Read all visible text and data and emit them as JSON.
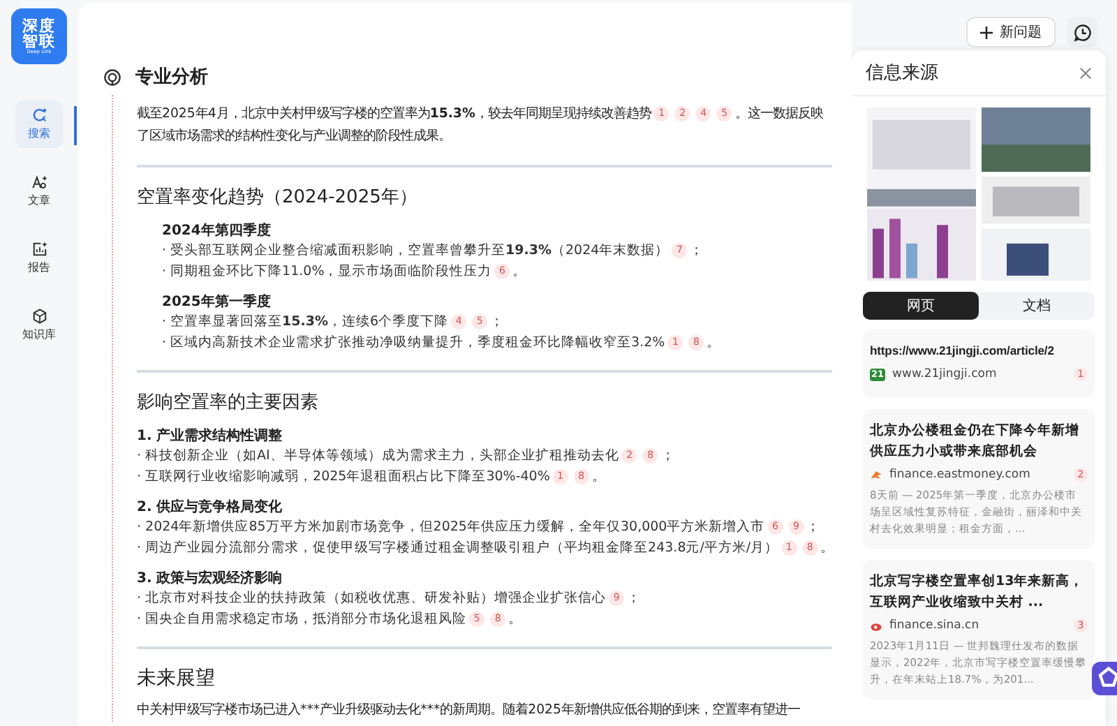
{
  "logo": {
    "line1": "深度",
    "line2": "智联",
    "sub": "Deep Link"
  },
  "nav": [
    {
      "label": "搜索",
      "selected": true
    },
    {
      "label": "文章",
      "selected": false
    },
    {
      "label": "报告",
      "selected": false
    },
    {
      "label": "知识库",
      "selected": false
    }
  ],
  "new_question_button": "新问题",
  "analysis": {
    "title": "专业分析",
    "intro": {
      "text": "截至2025年4月，北京中关村甲级写字楼的空置率为**15.3%**，较去年同期呈现持续改善趋势",
      "cites": [
        "1",
        "2",
        "4",
        "5"
      ],
      "after": "。这一数据反映了区域市场需求的结构性变化与产业调整的阶段性成果。"
    },
    "sections": [
      {
        "title": "空置率变化趋势（2024-2025年）",
        "indented": true,
        "groups": [
          {
            "title": "2024年第四季度",
            "bullets": [
              {
                "text": "· 受头部互联网企业整合缩减面积影响，空置率曾攀升至**19.3%**（2024年末数据）",
                "cites": [
                  "7"
                ],
                "after": "；"
              },
              {
                "text": "· 同期租金环比下降11.0%，显示市场面临阶段性压力",
                "cites": [
                  "6"
                ],
                "after": "。"
              }
            ]
          },
          {
            "title": "2025年第一季度",
            "bullets": [
              {
                "text": "· 空置率显著回落至**15.3%**，连续6个季度下降",
                "cites": [
                  "4",
                  "5"
                ],
                "after": "；"
              },
              {
                "text": "· 区域内高新技术企业需求扩张推动净吸纳量提升，季度租金环比降幅收窄至3.2%",
                "cites": [
                  "1",
                  "8"
                ],
                "after": "。"
              }
            ]
          }
        ]
      },
      {
        "title": "影响空置率的主要因素",
        "indented": false,
        "groups": [
          {
            "title": "1. 产业需求结构性调整",
            "bullets": [
              {
                "text": "· 科技创新企业（如AI、半导体等领域）成为需求主力，头部企业扩租推动去化",
                "cites": [
                  "2",
                  "8"
                ],
                "after": "；"
              },
              {
                "text": "· 互联网行业收缩影响减弱，2025年退租面积占比下降至30%-40%",
                "cites": [
                  "1",
                  "8"
                ],
                "after": "。"
              }
            ]
          },
          {
            "title": "2. 供应与竞争格局变化",
            "bullets": [
              {
                "text": "· 2024年新增供应85万平方米加剧市场竞争，但2025年供应压力缓解，全年仅30,000平方米新增入市",
                "cites": [
                  "6",
                  "9"
                ],
                "after": "；"
              },
              {
                "text": "· 周边产业园分流部分需求，促使甲级写字楼通过租金调整吸引租户（平均租金降至243.8元/平方米/月）",
                "cites": [
                  "1",
                  "8"
                ],
                "after": "。"
              }
            ]
          },
          {
            "title": "3. 政策与宏观经济影响",
            "bullets": [
              {
                "text": "· 北京市对科技企业的扶持政策（如税收优惠、研发补贴）增强企业扩张信心",
                "cites": [
                  "9"
                ],
                "after": "；"
              },
              {
                "text": "· 国央企自用需求稳定市场，抵消部分市场化退租风险",
                "cites": [
                  "5",
                  "8"
                ],
                "after": "。"
              }
            ]
          }
        ]
      }
    ],
    "outlook": {
      "title": "未来展望",
      "text": "中关村甲级写字楼市场已进入***产业升级驱动去化***的新周期。随着2025年新增供应低谷期的到来，空置率有望进一"
    }
  },
  "sources": {
    "title": "信息来源",
    "tabs": [
      {
        "label": "网页",
        "selected": true
      },
      {
        "label": "文档",
        "selected": false
      }
    ],
    "items": [
      {
        "kind": "twentyone",
        "title": "https://www.21jingji.com/article/2",
        "badge": "21",
        "site": "www.21jingji.com",
        "num": "1"
      },
      {
        "kind": "eastmoney",
        "title": "北京办公楼租金仍在下降今年新增供应压力小或带来底部机会",
        "site": "finance.eastmoney.com",
        "num": "2",
        "snippet": "8天前 — 2025年第一季度，北京办公楼市场呈区域性复苏特征，金融街，丽泽和中关村去化效果明显；租金方面，..."
      },
      {
        "kind": "sina",
        "title": "北京写字楼空置率创13年来新高，互联网产业收缩致中关村 ...",
        "site": "finance.sina.cn",
        "num": "3",
        "snippet": "2023年1月11日 — 世邦魏理仕发布的数据显示，2022年，北京市写字楼空置率缓慢攀升，在年末站上18.7%，为201..."
      }
    ]
  }
}
